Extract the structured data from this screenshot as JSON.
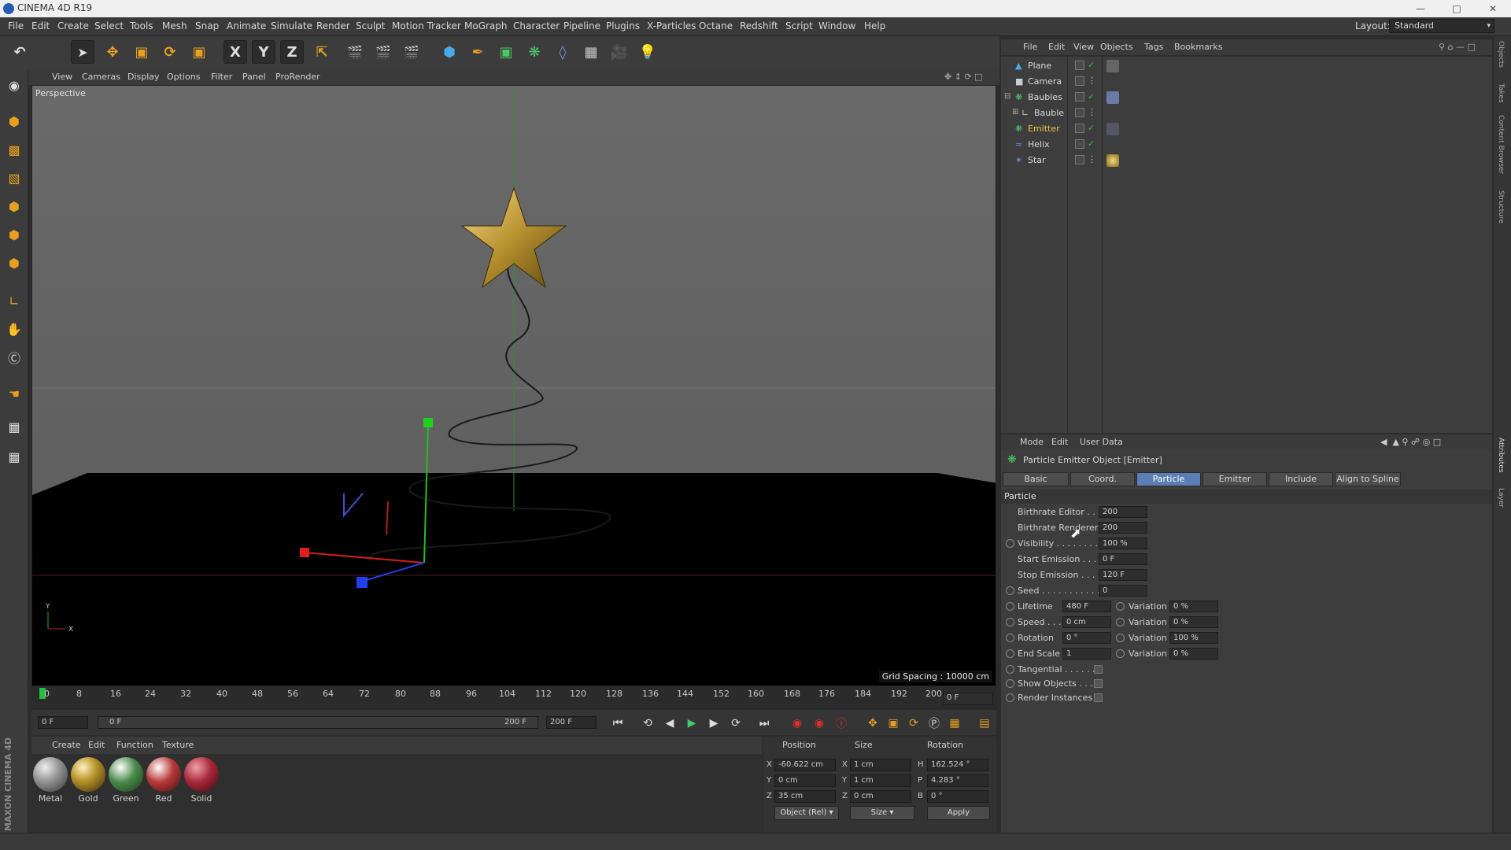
{
  "window": {
    "title": "CINEMA 4D R19"
  },
  "menubar": {
    "items": [
      "File",
      "Edit",
      "Create",
      "Select",
      "Tools",
      "Mesh",
      "Snap",
      "Animate",
      "Simulate",
      "Render",
      "Sculpt",
      "Motion Tracker",
      "MoGraph",
      "Character",
      "Pipeline",
      "Plugins",
      "X-Particles",
      "Octane",
      "Redshift",
      "Script",
      "Window",
      "Help"
    ],
    "layout_label": "Layout:",
    "layout_value": "Standard"
  },
  "toolbar": {
    "icons": [
      "undo-icon",
      "select-arrow-icon",
      "move-icon",
      "scale-icon",
      "rotate-icon",
      "recent-tool-icon",
      "x-axis-icon",
      "y-axis-icon",
      "z-axis-icon",
      "world-coord-icon",
      "render-view-icon",
      "render-picture-viewer-icon",
      "render-settings-icon",
      "cube-icon",
      "pen-icon",
      "subdivision-icon",
      "cloner-icon",
      "deformer-icon",
      "floor-icon",
      "camera-icon",
      "light-icon"
    ],
    "axis_x": "X",
    "axis_y": "Y",
    "axis_z": "Z"
  },
  "viewport": {
    "menu": [
      "View",
      "Cameras",
      "Display",
      "Options",
      "Filter",
      "Panel",
      "ProRender"
    ],
    "label": "Perspective",
    "grid_spacing": "Grid Spacing : 10000 cm"
  },
  "timeline": {
    "ticks": [
      "0",
      "8",
      "16",
      "24",
      "32",
      "40",
      "48",
      "56",
      "64",
      "72",
      "80",
      "88",
      "96",
      "104",
      "112",
      "120",
      "128",
      "136",
      "144",
      "152",
      "160",
      "168",
      "176",
      "184",
      "192",
      "200"
    ],
    "current_frame": "0 F",
    "start_field": "0 F",
    "range_start": "0 F",
    "range_end": "200 F",
    "end_field": "200 F"
  },
  "materials": {
    "menu": [
      "Create",
      "Edit",
      "Function",
      "Texture"
    ],
    "items": [
      {
        "name": "Metal",
        "color": "#9a9a9a"
      },
      {
        "name": "Gold",
        "color": "#b8942a"
      },
      {
        "name": "Green",
        "color": "#4a8a4a"
      },
      {
        "name": "Red",
        "color": "#b83838"
      },
      {
        "name": "Solid",
        "color": "#a8283a"
      }
    ]
  },
  "coordinates": {
    "headers": {
      "position": "Position",
      "size": "Size",
      "rotation": "Rotation"
    },
    "rows": [
      {
        "axis": "X",
        "pos": "-60.622 cm",
        "saxis": "X",
        "size": "1 cm",
        "raxis": "H",
        "rot": "162.524 °"
      },
      {
        "axis": "Y",
        "pos": "0 cm",
        "saxis": "Y",
        "size": "1 cm",
        "raxis": "P",
        "rot": "4.283 °"
      },
      {
        "axis": "Z",
        "pos": "35 cm",
        "saxis": "Z",
        "size": "0 cm",
        "raxis": "B",
        "rot": "0 °"
      }
    ],
    "mode": "Object (Rel)",
    "size_mode": "Size",
    "apply": "Apply"
  },
  "object_manager": {
    "menu": [
      "File",
      "Edit",
      "View",
      "Objects",
      "Tags",
      "Bookmarks"
    ],
    "objects": [
      {
        "name": "Plane",
        "indent": 0,
        "selected": false,
        "tick": true
      },
      {
        "name": "Camera",
        "indent": 0,
        "selected": false,
        "tick": false
      },
      {
        "name": "Baubles",
        "indent": 0,
        "selected": false,
        "tick": true
      },
      {
        "name": "Bauble",
        "indent": 1,
        "selected": false,
        "tick": false
      },
      {
        "name": "Emitter",
        "indent": 0,
        "selected": true,
        "tick": true
      },
      {
        "name": "Helix",
        "indent": 0,
        "selected": false,
        "tick": true
      },
      {
        "name": "Star",
        "indent": 0,
        "selected": false,
        "tick": false
      }
    ]
  },
  "attribute_manager": {
    "menu": [
      "Mode",
      "Edit",
      "User Data"
    ],
    "title": "Particle Emitter Object [Emitter]",
    "tabs": [
      "Basic",
      "Coord.",
      "Particle",
      "Emitter",
      "Include",
      "Align to Spline"
    ],
    "active_tab": "Particle",
    "section": "Particle",
    "fields": [
      {
        "label": "Birthrate Editor . . .",
        "value": "200"
      },
      {
        "label": "Birthrate Renderer",
        "value": "200"
      },
      {
        "label": "Visibility . . . . . . . . .",
        "value": "100 %"
      },
      {
        "label": "Start Emission . . .",
        "value": "0 F"
      },
      {
        "label": "Stop Emission . . .",
        "value": "120 F"
      },
      {
        "label": "Seed . . . . . . . . . . . .",
        "value": "0"
      }
    ],
    "pairs": [
      {
        "label": "Lifetime",
        "value": "480 F",
        "var_label": "Variation",
        "var": "0 %"
      },
      {
        "label": "Speed . . .",
        "value": "0 cm",
        "var_label": "Variation",
        "var": "0 %"
      },
      {
        "label": "Rotation",
        "value": "0 °",
        "var_label": "Variation",
        "var": "100 %"
      },
      {
        "label": "End Scale",
        "value": "1",
        "var_label": "Variation",
        "var": "0 %"
      }
    ],
    "checks": [
      {
        "label": "Tangential . . . . . ."
      },
      {
        "label": "Show Objects . . ."
      },
      {
        "label": "Render Instances"
      }
    ]
  },
  "right_strip": [
    "Objects",
    "Takes",
    "Content Browser",
    "Structure",
    "Attributes",
    "Layer"
  ],
  "branding": "MAXON CINEMA 4D"
}
